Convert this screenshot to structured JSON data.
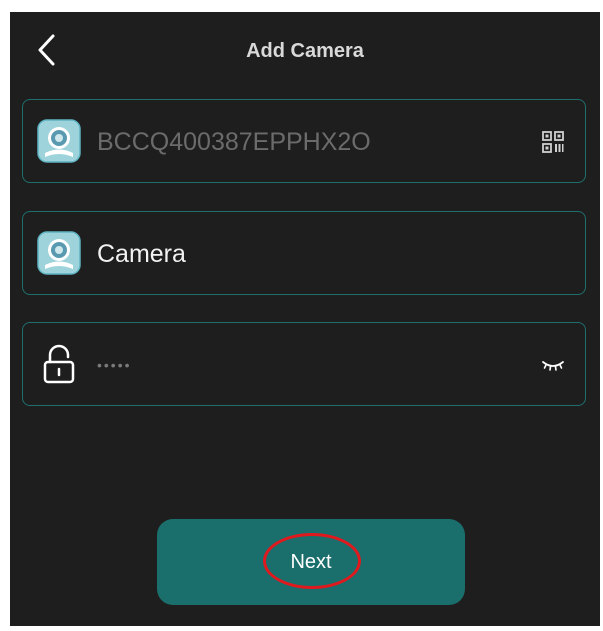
{
  "header": {
    "title": "Add Camera",
    "back_icon": "chevron-left-icon"
  },
  "fields": {
    "device_id": {
      "value": "BCCQ400387EPPHX2O",
      "icon": "camera-app-icon",
      "action_icon": "qr-code-scan-icon"
    },
    "device_name": {
      "value": "Camera",
      "icon": "camera-app-icon"
    },
    "password": {
      "value": "•••••",
      "icon": "lock-icon",
      "action_icon": "eye-closed-icon"
    }
  },
  "actions": {
    "next_label": "Next"
  },
  "colors": {
    "background": "#1e1e1e",
    "accent": "#1a6e6b",
    "field_border": "#1f6f6c",
    "annotation": "#e0191e"
  }
}
